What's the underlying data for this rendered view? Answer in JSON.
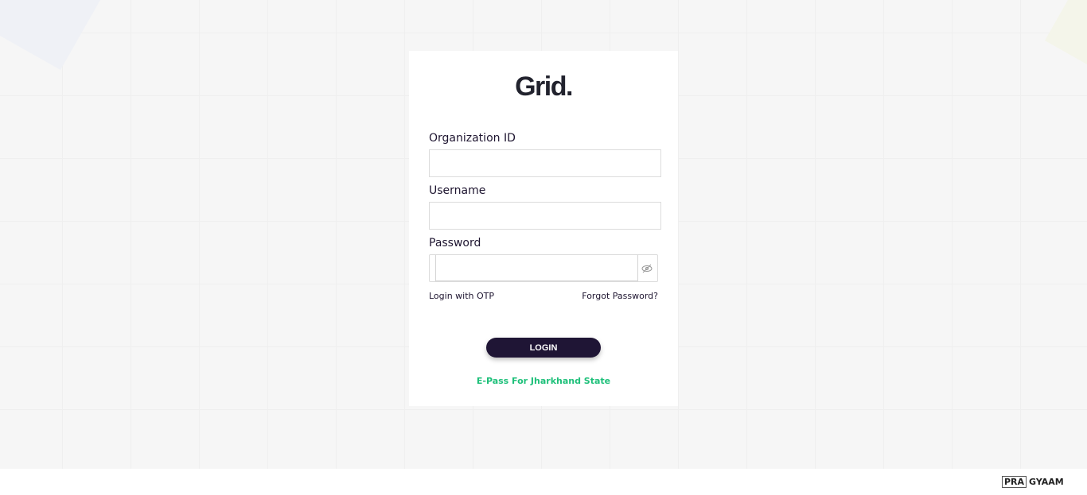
{
  "logo": "Grid.",
  "form": {
    "org_label": "Organization ID",
    "org_value": "",
    "username_label": "Username",
    "username_value": "",
    "password_label": "Password",
    "password_value": "",
    "login_otp": "Login with OTP",
    "forgot": "Forgot Password?",
    "login_button": "LOGIN",
    "epass_link": "E-Pass For Jharkhand State"
  },
  "footer": {
    "brand_a": "PRA",
    "brand_b": "GYAAM"
  },
  "colors": {
    "button": "#1f1535",
    "epass": "#1ec07a",
    "text": "#1e1530"
  }
}
